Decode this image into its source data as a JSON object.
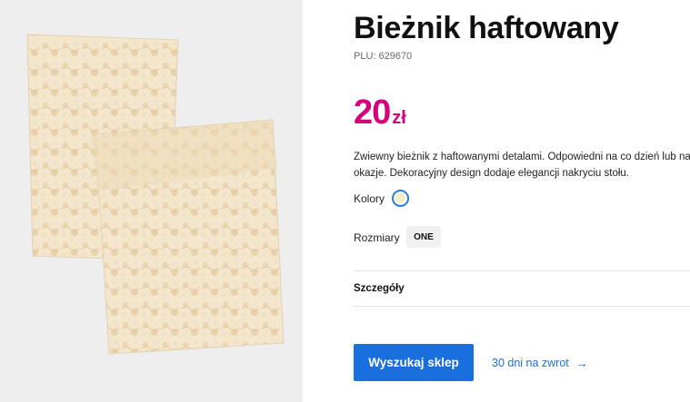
{
  "product": {
    "title": "Bieżnik haftowany",
    "plu_label": "PLU:",
    "plu_value": "629670",
    "price_amount": "20",
    "price_currency": "zł",
    "description": "Zwiewny bieżnik z haftowanymi detalami. Odpowiedni na co dzień lub na okazje. Dekoracyjny design dodaje elegancji nakryciu stołu.",
    "colors_label": "Kolory",
    "selected_color": "#f4eec7",
    "sizes_label": "Rozmiary",
    "size_option": "ONE",
    "details_label": "Szczegóły"
  },
  "actions": {
    "find_store": "Wyszukaj sklep",
    "returns": "30 dni na zwrot"
  },
  "colors": {
    "price": "#d6007c",
    "accent": "#1a6fde",
    "image_background": "#eeeeee"
  },
  "icons": {
    "returns_arrow": "arrow-right-icon"
  }
}
